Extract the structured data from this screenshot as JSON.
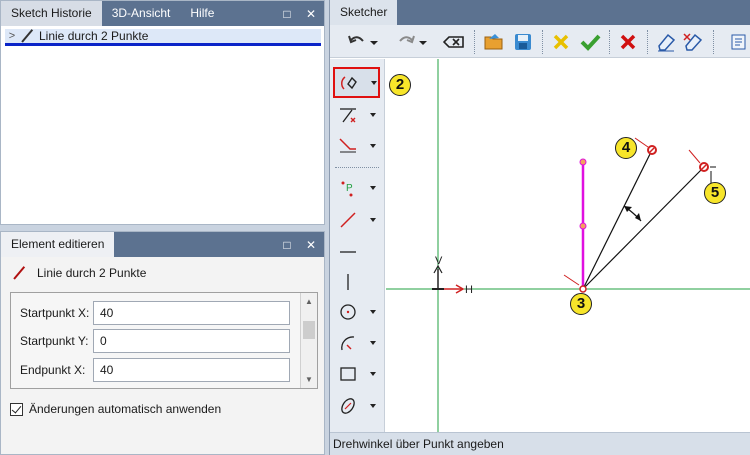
{
  "history_panel": {
    "tabs": [
      "Sketch Historie",
      "3D-Ansicht",
      "Hilfe"
    ],
    "window_buttons": [
      "□",
      "✕"
    ],
    "item": {
      "label": "Linie durch 2 Punkte"
    }
  },
  "edit_panel": {
    "tab": "Element editieren",
    "window_buttons": [
      "□",
      "✕"
    ],
    "element_title": "Linie durch 2 Punkte",
    "fields": [
      {
        "label": "Startpunkt X:",
        "value": "40"
      },
      {
        "label": "Startpunkt Y:",
        "value": "0"
      },
      {
        "label": "Endpunkt X:",
        "value": "40"
      }
    ],
    "auto_apply": {
      "label": "Änderungen automatisch anwenden",
      "checked": true
    }
  },
  "sketcher": {
    "tab": "Sketcher",
    "status": "Drehwinkel über Punkt angeben",
    "badges": [
      "2",
      "3",
      "4",
      "5"
    ],
    "axis_labels": {
      "x": "H",
      "y": "V"
    }
  },
  "colors": {
    "accent_blue": "#0a24c8",
    "highlight_red": "#e01010",
    "magenta": "#e010e0",
    "axis_green": "#20a040",
    "badge_yellow": "#f7e52a"
  }
}
